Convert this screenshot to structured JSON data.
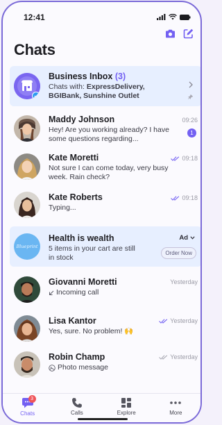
{
  "status_bar": {
    "time": "12:41"
  },
  "header": {
    "title": "Chats"
  },
  "chats": [
    {
      "name": "Business Inbox",
      "count": "(3)",
      "preview_prefix": "Chats with: ",
      "preview_bold": "ExpressDelivery, BGIBank, Sunshine Outlet",
      "time": ""
    },
    {
      "name": "Maddy Johnson",
      "preview": "Hey! Are you working already? I have some questions regarding...",
      "time": "09:26",
      "unread": "1"
    },
    {
      "name": "Kate Moretti",
      "preview": "Not sure I can come today, very busy week. Rain check?",
      "time": "09:18"
    },
    {
      "name": "Kate Roberts",
      "preview": "Typing...",
      "time": "09:18"
    },
    {
      "name": "Health is wealth",
      "preview": "5 items in your cart are still in stock",
      "ad_label": "Ad",
      "button": "Order Now",
      "avatar_text": "Blueprint"
    },
    {
      "name": "Giovanni Moretti",
      "preview": "Incoming call",
      "time": "Yesterday"
    },
    {
      "name": "Lisa Kantor",
      "preview": "Yes, sure. No problem! 🙌",
      "time": "Yesterday"
    },
    {
      "name": "Robin Champ",
      "preview": "Photo message",
      "time": "Yesterday"
    }
  ],
  "bottom_nav": {
    "items": [
      {
        "label": "Chats",
        "badge": "3"
      },
      {
        "label": "Calls"
      },
      {
        "label": "Explore"
      },
      {
        "label": "More"
      }
    ]
  },
  "colors": {
    "accent": "#7360f2",
    "highlight": "#e7efff",
    "badge_red": "#f0555a"
  }
}
